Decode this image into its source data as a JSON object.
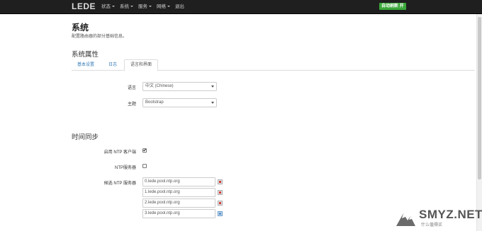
{
  "navbar": {
    "brand": "LEDE",
    "menu": [
      {
        "label": "状态",
        "has_caret": true
      },
      {
        "label": "系统",
        "has_caret": true
      },
      {
        "label": "服务",
        "has_caret": true
      },
      {
        "label": "网络",
        "has_caret": true
      },
      {
        "label": "退出",
        "has_caret": false
      }
    ],
    "refresh_badge": "自动刷新 开",
    "refresh_badge_color": "#3aa83a"
  },
  "page": {
    "title": "系统",
    "description": "配置路由器的部分基础信息。"
  },
  "system_properties": {
    "title": "系统属性",
    "tabs": [
      {
        "label": "基本设置",
        "active": false
      },
      {
        "label": "日志",
        "active": false
      },
      {
        "label": "语言和界面",
        "active": true
      }
    ],
    "language_label": "语言",
    "language_value": "中文 (Chinese)",
    "theme_label": "主题",
    "theme_value": "Bootstrap"
  },
  "time_sync": {
    "title": "时间同步",
    "enable_ntp_label": "启用 NTP 客户端",
    "enable_ntp_checked": true,
    "ntp_server_label": "NTP服务器",
    "ntp_server_checked": false,
    "candidate_label": "候选 NTP 服务器",
    "servers": [
      "0.lede.pool.ntp.org",
      "1.lede.pool.ntp.org",
      "2.lede.pool.ntp.org",
      "3.lede.pool.ntp.org"
    ]
  },
  "watermark": {
    "text": "SMYZ.NET",
    "subtext": "什么值得买"
  }
}
